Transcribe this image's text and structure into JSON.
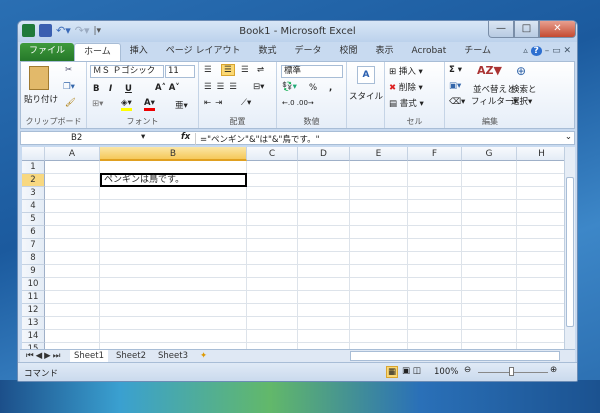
{
  "window": {
    "title": "Book1 - Microsoft Excel"
  },
  "tabs": [
    {
      "label": "ファイル"
    },
    {
      "label": "ホーム"
    },
    {
      "label": "挿入"
    },
    {
      "label": "ページ レイアウト"
    },
    {
      "label": "数式"
    },
    {
      "label": "データ"
    },
    {
      "label": "校閲"
    },
    {
      "label": "表示"
    },
    {
      "label": "Acrobat"
    },
    {
      "label": "チーム"
    }
  ],
  "ribbon": {
    "clipboard": {
      "paste": "貼り付け",
      "label": "クリップボード"
    },
    "font": {
      "name": "ＭＳ Ｐゴシック",
      "size": "11",
      "bold": "B",
      "italic": "I",
      "underline": "U",
      "label": "フォント"
    },
    "alignment": {
      "label": "配置"
    },
    "number": {
      "format": "標準",
      "percent": "%",
      "comma": ",",
      "label": "数値"
    },
    "styles": {
      "style": "スタイル"
    },
    "cells": {
      "insert": "挿入",
      "delete": "削除",
      "format": "書式",
      "label": "セル"
    },
    "editing": {
      "sigma": "Σ",
      "sort": "並べ替えと",
      "sort2": "フィルター",
      "find": "検索と",
      "find2": "選択",
      "label": "編集"
    }
  },
  "formula_bar": {
    "name_box": "B2",
    "fx": "fx",
    "formula": "=\"ペンギン\"&\"は\"&\"鳥です。\""
  },
  "grid": {
    "columns": [
      "A",
      "B",
      "C",
      "D",
      "E",
      "F",
      "G",
      "H"
    ],
    "rows": [
      "1",
      "2",
      "3",
      "4",
      "5",
      "6",
      "7",
      "8",
      "9",
      "10",
      "11",
      "12",
      "13",
      "14",
      "15"
    ],
    "active_cell": "B2",
    "cells": {
      "B2": "ペンギンは鳥です。"
    }
  },
  "sheets": [
    "Sheet1",
    "Sheet2",
    "Sheet3"
  ],
  "status": {
    "mode": "コマンド",
    "zoom": "100%"
  },
  "colors": {
    "file_tab": "#2e8a32",
    "selection_header": "#f5c85a"
  }
}
